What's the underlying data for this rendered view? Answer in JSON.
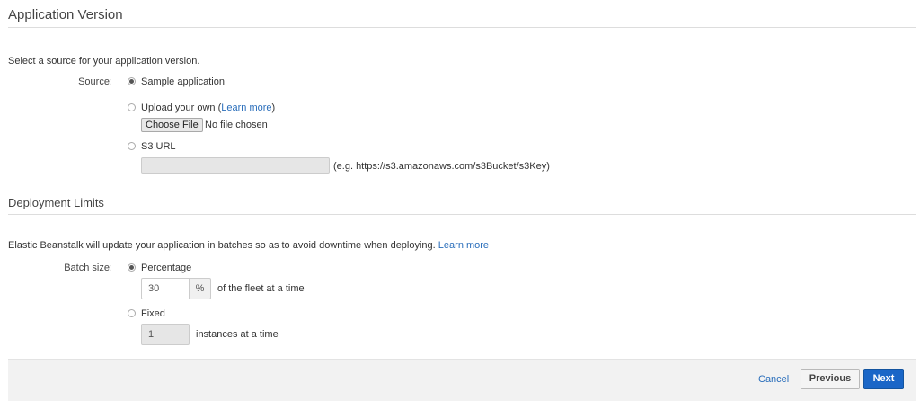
{
  "app_version": {
    "title": "Application Version",
    "intro": "Select a source for your application version.",
    "source_label": "Source:",
    "options": {
      "sample": {
        "label": "Sample application",
        "checked": true
      },
      "upload": {
        "label": "Upload your own (",
        "link": "Learn more",
        "suffix": ")",
        "checked": false
      },
      "s3": {
        "label": "S3 URL",
        "checked": false
      }
    },
    "choose_file_label": "Choose File",
    "no_file_text": "No file chosen",
    "s3_url_value": "",
    "s3_hint": "(e.g. https://s3.amazonaws.com/s3Bucket/s3Key)"
  },
  "deployment": {
    "title": "Deployment Limits",
    "intro": "Elastic Beanstalk will update your application in batches so as to avoid downtime when deploying.",
    "learn_more": "Learn more",
    "batch_size_label": "Batch size:",
    "percentage": {
      "label": "Percentage",
      "checked": true,
      "value": "30",
      "unit": "%",
      "suffix": "of the fleet at a time"
    },
    "fixed": {
      "label": "Fixed",
      "checked": false,
      "value": "1",
      "suffix": "instances at a time"
    }
  },
  "footer": {
    "cancel": "Cancel",
    "previous": "Previous",
    "next": "Next"
  },
  "colors": {
    "link": "#2a6ebb",
    "primary_button": "#1a66c7"
  }
}
